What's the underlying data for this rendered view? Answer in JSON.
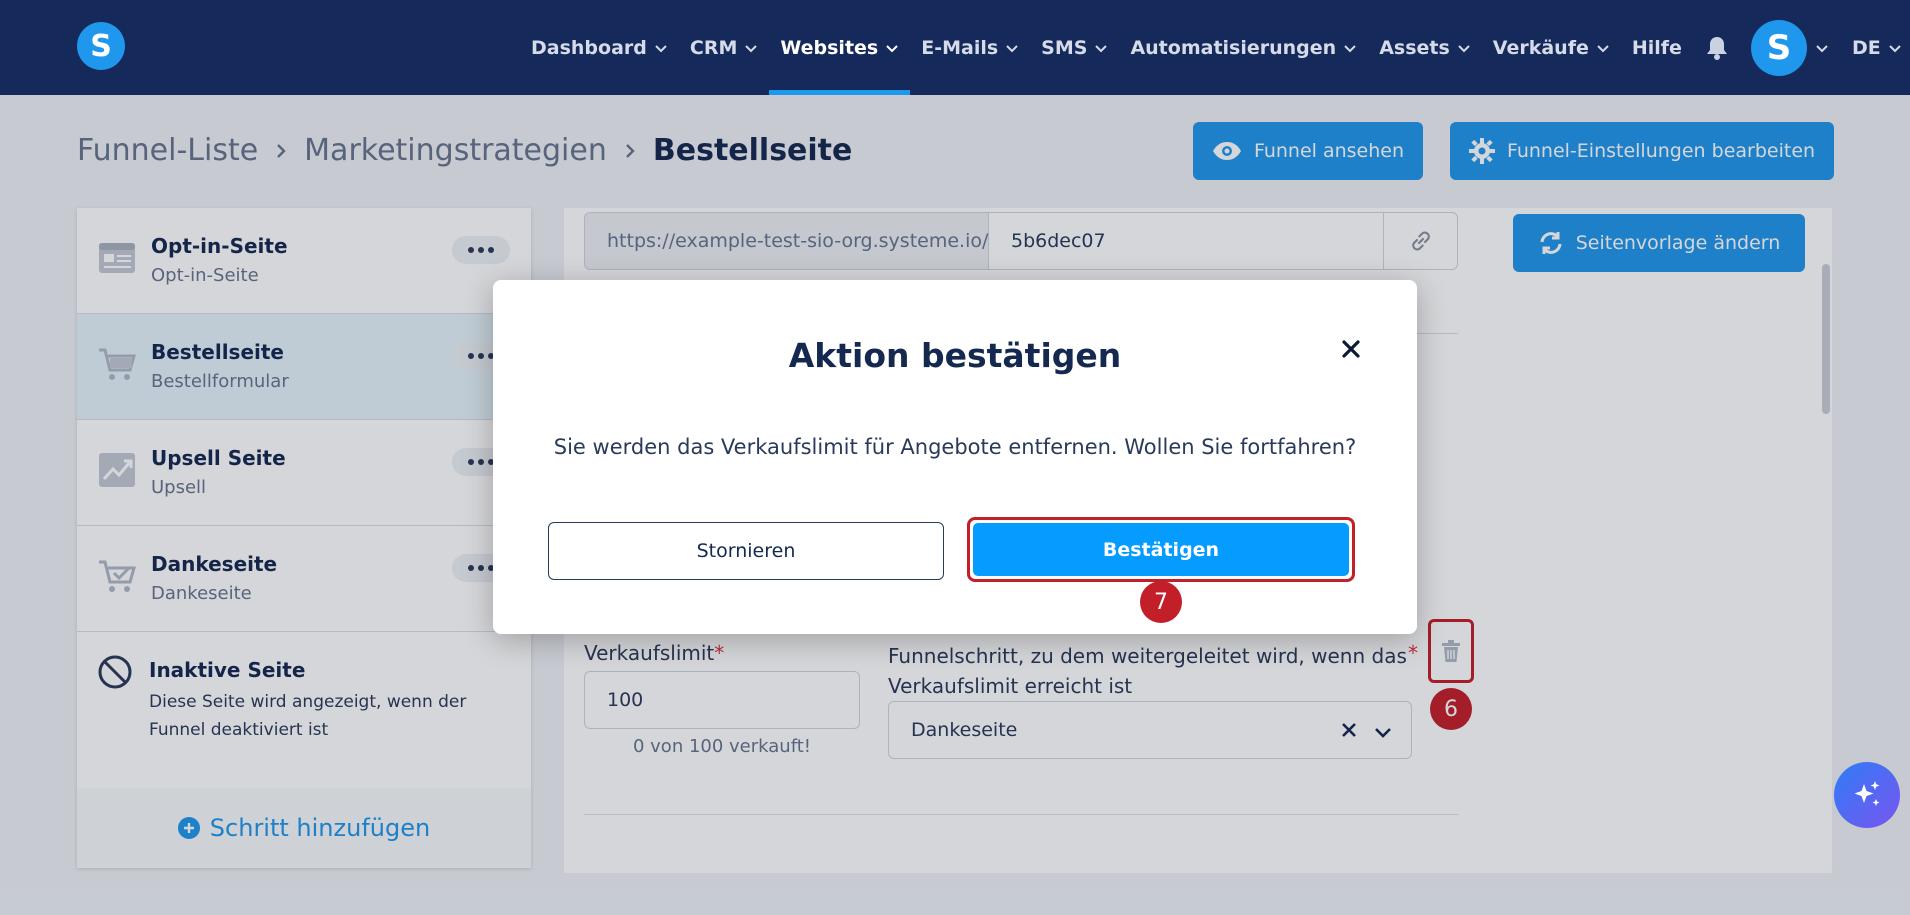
{
  "topbar": {
    "logo_letter": "S",
    "nav": [
      {
        "label": "Dashboard",
        "has_dropdown": true
      },
      {
        "label": "CRM",
        "has_dropdown": true
      },
      {
        "label": "Websites",
        "has_dropdown": true,
        "active": true
      },
      {
        "label": "E-Mails",
        "has_dropdown": true
      },
      {
        "label": "SMS",
        "has_dropdown": true
      },
      {
        "label": "Automatisierungen",
        "has_dropdown": true
      },
      {
        "label": "Assets",
        "has_dropdown": true
      },
      {
        "label": "Verkäufe",
        "has_dropdown": true
      },
      {
        "label": "Hilfe",
        "has_dropdown": false
      }
    ],
    "avatar_letter": "S",
    "language": "DE"
  },
  "breadcrumb": {
    "items": [
      "Funnel-Liste",
      "Marketingstrategien",
      "Bestellseite"
    ]
  },
  "actions": {
    "view_funnel": "Funnel ansehen",
    "edit_settings": "Funnel-Einstellungen bearbeiten"
  },
  "sidebar": {
    "steps": [
      {
        "title": "Opt-in-Seite",
        "subtitle": "Opt-in-Seite",
        "icon": "optin-form-icon"
      },
      {
        "title": "Bestellseite",
        "subtitle": "Bestellformular",
        "icon": "cart-icon",
        "active": true
      },
      {
        "title": "Upsell Seite",
        "subtitle": "Upsell",
        "icon": "trend-chart-icon"
      },
      {
        "title": "Dankeseite",
        "subtitle": "Dankeseite",
        "icon": "cart-check-icon"
      }
    ],
    "inactive": {
      "title": "Inaktive Seite",
      "description": "Diese Seite wird angezeigt, wenn der Funnel deaktiviert ist"
    },
    "add_step": "Schritt hinzufügen"
  },
  "content": {
    "url_prefix": "https://example-test-sio-org.systeme.io/",
    "url_slug": "5b6dec07",
    "change_template": "Seitenvorlage ändern",
    "limit_label": "Verkaufslimit",
    "limit_value": "100",
    "limit_note": "0 von 100 verkauft!",
    "redirect_label": "Funnelschritt, zu dem weitergeleitet wird, wenn das Verkaufslimit erreicht ist",
    "redirect_value": "Dankeseite",
    "required_mark": "*"
  },
  "annotations": {
    "step6": "6",
    "step7": "7"
  },
  "modal": {
    "title": "Aktion bestätigen",
    "message": "Sie werden das Verkaufslimit für Angebote entfernen. Wollen Sie fortfahren?",
    "cancel": "Stornieren",
    "confirm": "Bestätigen"
  },
  "colors": {
    "navbar": "#15295a",
    "primary": "#1f97ec",
    "confirm": "#069bff",
    "annotation_red": "#c21f28"
  }
}
